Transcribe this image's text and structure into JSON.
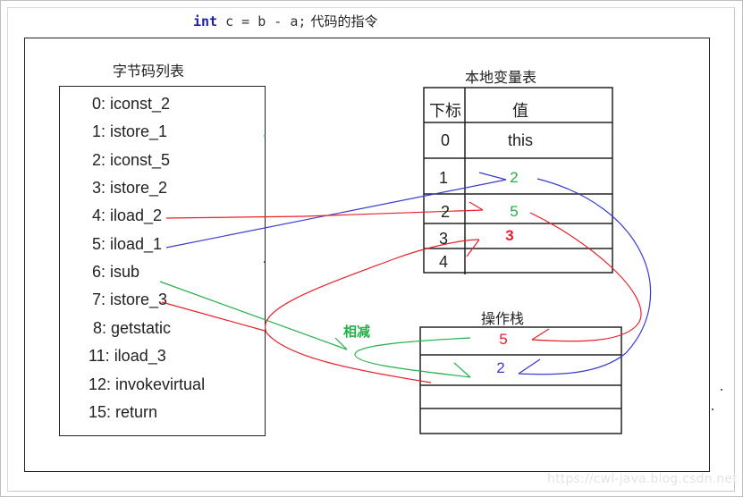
{
  "title": {
    "keyword": "int",
    "code": " c = b - a;",
    "caption": "代码的指令"
  },
  "bytecode_list": {
    "heading": "字节码列表",
    "items": [
      "0: iconst_2",
      "1: istore_1",
      "2: iconst_5",
      "3: istore_2",
      "4: iload_2",
      "5: iload_1",
      "6: isub",
      "7: istore_3",
      "8: getstatic",
      "11: iload_3",
      "12: invokevirtual",
      "15: return"
    ]
  },
  "local_variable_table": {
    "heading": "本地变量表",
    "columns": [
      "下标",
      "值"
    ],
    "rows": [
      {
        "index": "0",
        "value": "this"
      },
      {
        "index": "1",
        "value": "2"
      },
      {
        "index": "2",
        "value": "5"
      },
      {
        "index": "3",
        "value": "3"
      },
      {
        "index": "4",
        "value": ""
      }
    ]
  },
  "operand_stack": {
    "heading": "操作栈",
    "slots": [
      "5",
      "2",
      "",
      ""
    ]
  },
  "annotation": {
    "subtract_label": "相减"
  },
  "colors": {
    "red": "#e8202a",
    "blue": "#3a3ad0",
    "green": "#23b04a",
    "keyword": "#1f1fa8"
  },
  "watermark": "https://cwl-java.blog.csdn.net"
}
